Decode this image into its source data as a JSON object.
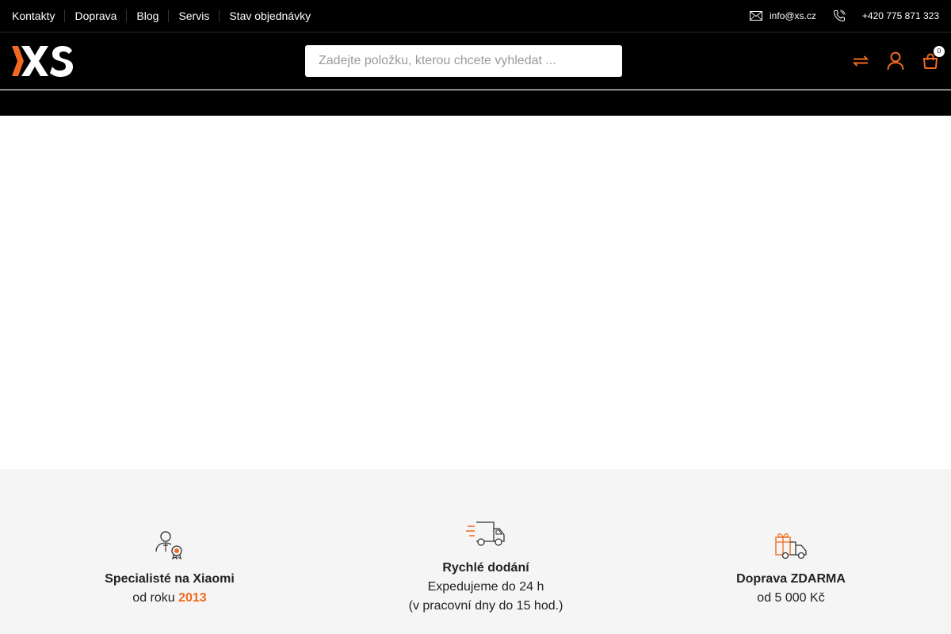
{
  "topnav": {
    "items": [
      "Kontakty",
      "Doprava",
      "Blog",
      "Servis",
      "Stav objednávky"
    ]
  },
  "contact": {
    "email": "info@xs.cz",
    "phone": "+420 775 871 323",
    "email_icon": "envelope-icon",
    "phone_icon": "phone-icon"
  },
  "header": {
    "logo_text": "XS",
    "search_placeholder": "Zadejte položku, kterou chcete vyhledat ...",
    "icons": [
      "compare-icon",
      "user-icon",
      "cart-icon"
    ],
    "cart_count": "0"
  },
  "features": [
    {
      "icon": "specialist-badge-icon",
      "title": "Specialisté na Xiaomi",
      "line1_prefix": "od roku ",
      "line1_highlight": "2013"
    },
    {
      "icon": "fast-delivery-truck-icon",
      "title": "Rychlé dodání",
      "line1": "Expedujeme do 24 h",
      "line2": "(v pracovní dny do 15 hod.)"
    },
    {
      "icon": "gift-truck-icon",
      "title": "Doprava ZDARMA",
      "line1": "od 5 000 Kč"
    }
  ],
  "colors": {
    "accent": "#f26a21",
    "header_bg": "#000000",
    "footer_bg": "#f5f5f5"
  }
}
